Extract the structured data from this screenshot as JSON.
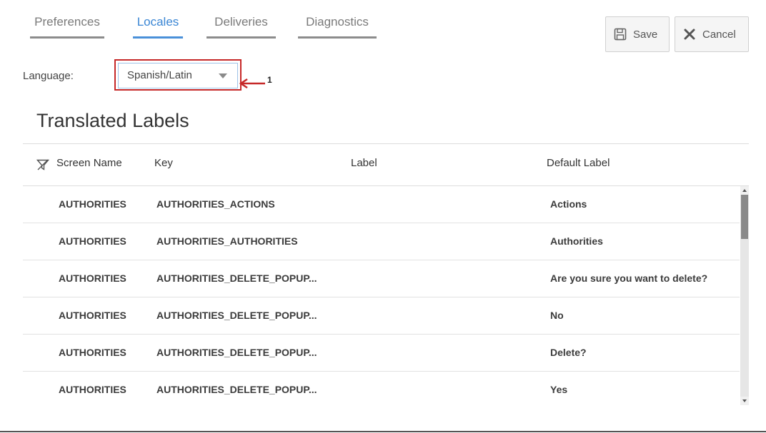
{
  "tabs": [
    {
      "label": "Preferences",
      "active": false
    },
    {
      "label": "Locales",
      "active": true
    },
    {
      "label": "Deliveries",
      "active": false
    },
    {
      "label": "Diagnostics",
      "active": false
    }
  ],
  "toolbar": {
    "save_label": "Save",
    "cancel_label": "Cancel",
    "save_icon": "floppy-disk-icon",
    "cancel_icon": "close-icon"
  },
  "language": {
    "label": "Language:",
    "selected": "Spanish/Latin"
  },
  "annotation": {
    "number": "1"
  },
  "section": {
    "title": "Translated Labels"
  },
  "table": {
    "columns": [
      "Screen Name",
      "Key",
      "Label",
      "Default Label"
    ],
    "rows": [
      {
        "screen": "AUTHORITIES",
        "key": "AUTHORITIES_ACTIONS",
        "label": "",
        "default": "Actions"
      },
      {
        "screen": "AUTHORITIES",
        "key": "AUTHORITIES_AUTHORITIES",
        "label": "",
        "default": "Authorities"
      },
      {
        "screen": "AUTHORITIES",
        "key": "AUTHORITIES_DELETE_POPUP...",
        "label": "",
        "default": "Are you sure you want to delete?"
      },
      {
        "screen": "AUTHORITIES",
        "key": "AUTHORITIES_DELETE_POPUP...",
        "label": "",
        "default": "No"
      },
      {
        "screen": "AUTHORITIES",
        "key": "AUTHORITIES_DELETE_POPUP...",
        "label": "",
        "default": "Delete?"
      },
      {
        "screen": "AUTHORITIES",
        "key": "AUTHORITIES_DELETE_POPUP...",
        "label": "",
        "default": "Yes"
      }
    ]
  },
  "colors": {
    "accent": "#4a90d9",
    "highlight": "#c62828"
  }
}
